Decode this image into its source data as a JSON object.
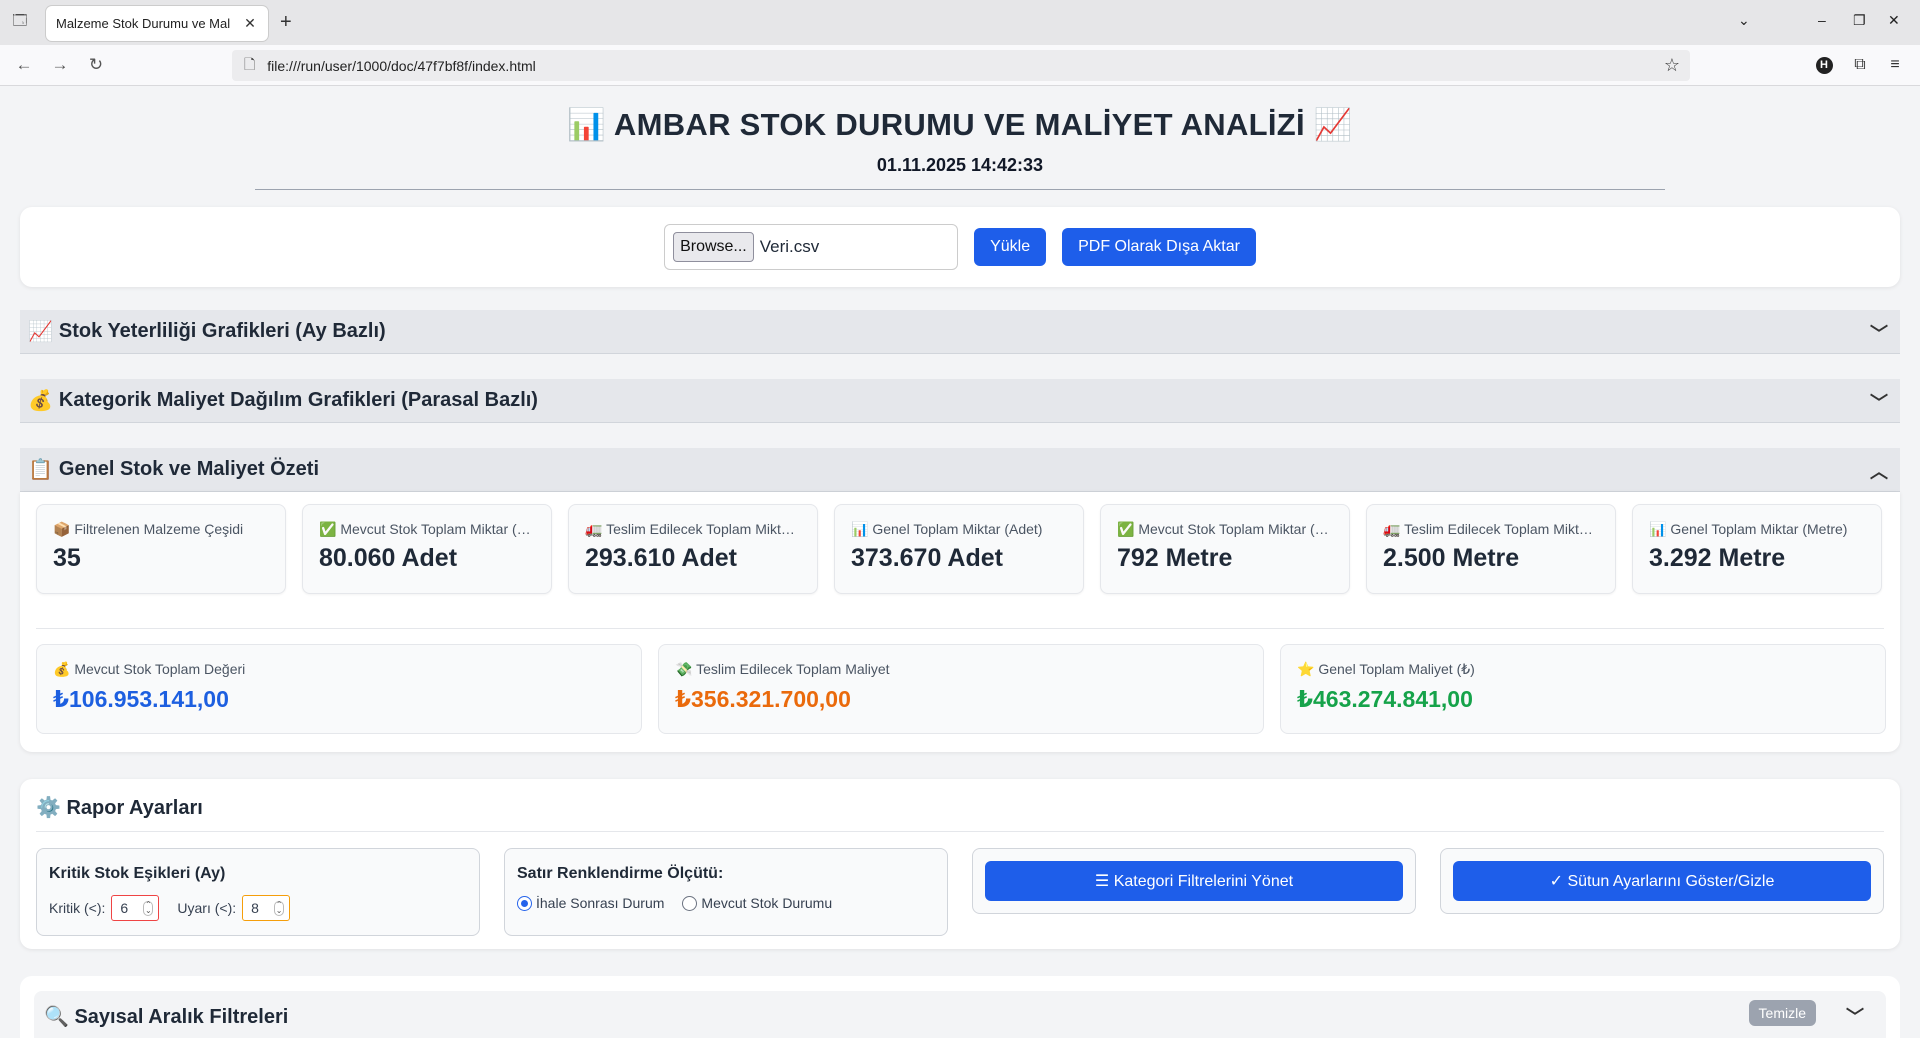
{
  "browser": {
    "tab_title": "Malzeme Stok Durumu ve Mal",
    "url": "file:///run/user/1000/doc/47f7bf8f/index.html"
  },
  "header": {
    "title": "📊 AMBAR STOK DURUMU VE MALİYET ANALİZİ 📈",
    "timestamp": "01.11.2025 14:42:33"
  },
  "upload": {
    "browse_label": "Browse...",
    "file_name": "Veri.csv",
    "load_label": "Yükle",
    "pdf_label": "PDF Olarak Dışa Aktar"
  },
  "sections": {
    "stock_charts": {
      "emoji": "📈",
      "title": "Stok Yeterliliği Grafikleri (Ay Bazlı)"
    },
    "cost_charts": {
      "emoji": "💰",
      "title": "Kategorik Maliyet Dağılım Grafikleri (Parasal Bazlı)"
    },
    "summary": {
      "emoji": "📋",
      "title": "Genel Stok ve Maliyet Özeti"
    }
  },
  "stats": [
    {
      "label": "📦 Filtrelenen Malzeme Çeşidi",
      "value": "35"
    },
    {
      "label": "✅ Mevcut Stok Toplam Miktar (Adet)",
      "value": "80.060 Adet"
    },
    {
      "label": "🚛 Teslim Edilecek Toplam Miktar (Adet)",
      "value": "293.610 Adet"
    },
    {
      "label": "📊 Genel Toplam Miktar (Adet)",
      "value": "373.670 Adet"
    },
    {
      "label": "✅ Mevcut Stok Toplam Miktar (Metre)",
      "value": "792 Metre"
    },
    {
      "label": "🚛 Teslim Edilecek Toplam Miktar (Metre)",
      "value": "2.500 Metre"
    },
    {
      "label": "📊 Genel Toplam Miktar (Metre)",
      "value": "3.292 Metre"
    }
  ],
  "costs": [
    {
      "label": "💰 Mevcut Stok Toplam Değeri",
      "value": "₺106.953.141,00",
      "color": "#1d5fe0"
    },
    {
      "label": "💸 Teslim Edilecek Toplam Maliyet",
      "value": "₺356.321.700,00",
      "color": "#ea6a0c"
    },
    {
      "label": "⭐ Genel Toplam Maliyet (₺)",
      "value": "₺463.274.841,00",
      "color": "#16a34a"
    }
  ],
  "settings": {
    "title": "⚙️ Rapor Ayarları",
    "threshold_title": "Kritik Stok Eşikleri (Ay)",
    "critical_label": "Kritik (<):",
    "critical_value": "6",
    "warning_label": "Uyarı (<):",
    "warning_value": "8",
    "coloring_title": "Satır Renklendirme Ölçütü:",
    "radio_1": "İhale Sonrası Durum",
    "radio_2": "Mevcut Stok Durumu",
    "category_btn": "☰ Kategori Filtrelerini Yönet",
    "columns_btn": "✓ Sütun Ayarlarını Göster/Gizle"
  },
  "filters": {
    "title": "🔍 Sayısal Aralık Filtreleri",
    "clear_label": "Temizle"
  }
}
